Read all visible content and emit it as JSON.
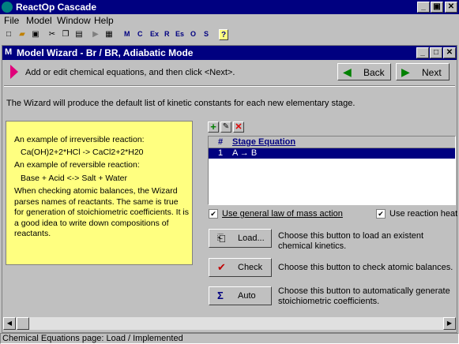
{
  "app": {
    "title": "ReactOp Cascade"
  },
  "window_controls": {
    "minimize": "_",
    "restore": "▣",
    "close": "✕"
  },
  "menu": [
    "File",
    "Model",
    "Window",
    "Help"
  ],
  "toolbar": {
    "text_buttons": [
      "M",
      "C",
      "Ex",
      "R",
      "Es",
      "O",
      "S"
    ],
    "help": "?"
  },
  "child": {
    "title": "Model Wizard - Br / BR, Adiabatic Mode",
    "icon": "M"
  },
  "wizard": {
    "instruction": "Add or edit chemical equations, and then click <Next>.",
    "back_label": "Back",
    "next_label": "Next",
    "banner": "The Wizard will produce the default list of kinetic constants for each new elementary stage."
  },
  "example": {
    "irreversible_heading": "An example of irreversible reaction:",
    "irreversible_eq": "Ca(OH)2+2*HCl -> CaCl2+2*H20",
    "reversible_heading": "An example of reversible reaction:",
    "reversible_eq": "Base + Acid <-> Salt + Water",
    "note": "When checking atomic balances, the Wizard parses names of reactants.  The same is true for generation of stoichiometric coefficients.  It is a good idea to write down compositions of reactants."
  },
  "stages": {
    "columns": [
      "#",
      "Stage Equation"
    ],
    "rows": [
      {
        "num": "1",
        "equation": "A → B"
      }
    ]
  },
  "options": {
    "mass_action": {
      "label": "Use general law of mass action",
      "checked": true
    },
    "reaction_heat": {
      "label": "Use reaction heat",
      "checked": true
    }
  },
  "actions": {
    "load": {
      "label": "Load...",
      "desc": "Choose this button to load an existent chemical kinetics."
    },
    "check": {
      "label": "Check",
      "desc": "Choose this button to check atomic balances."
    },
    "auto": {
      "label": "Auto",
      "desc": "Choose this button to automatically generate stoichiometric coefficients."
    }
  },
  "status": "Chemical Equations page:  Load / Implemented",
  "colors": {
    "title": "#000080",
    "yellow": "#ffff80",
    "nav_arrow": "#008000",
    "pointer": "#e0007a"
  }
}
